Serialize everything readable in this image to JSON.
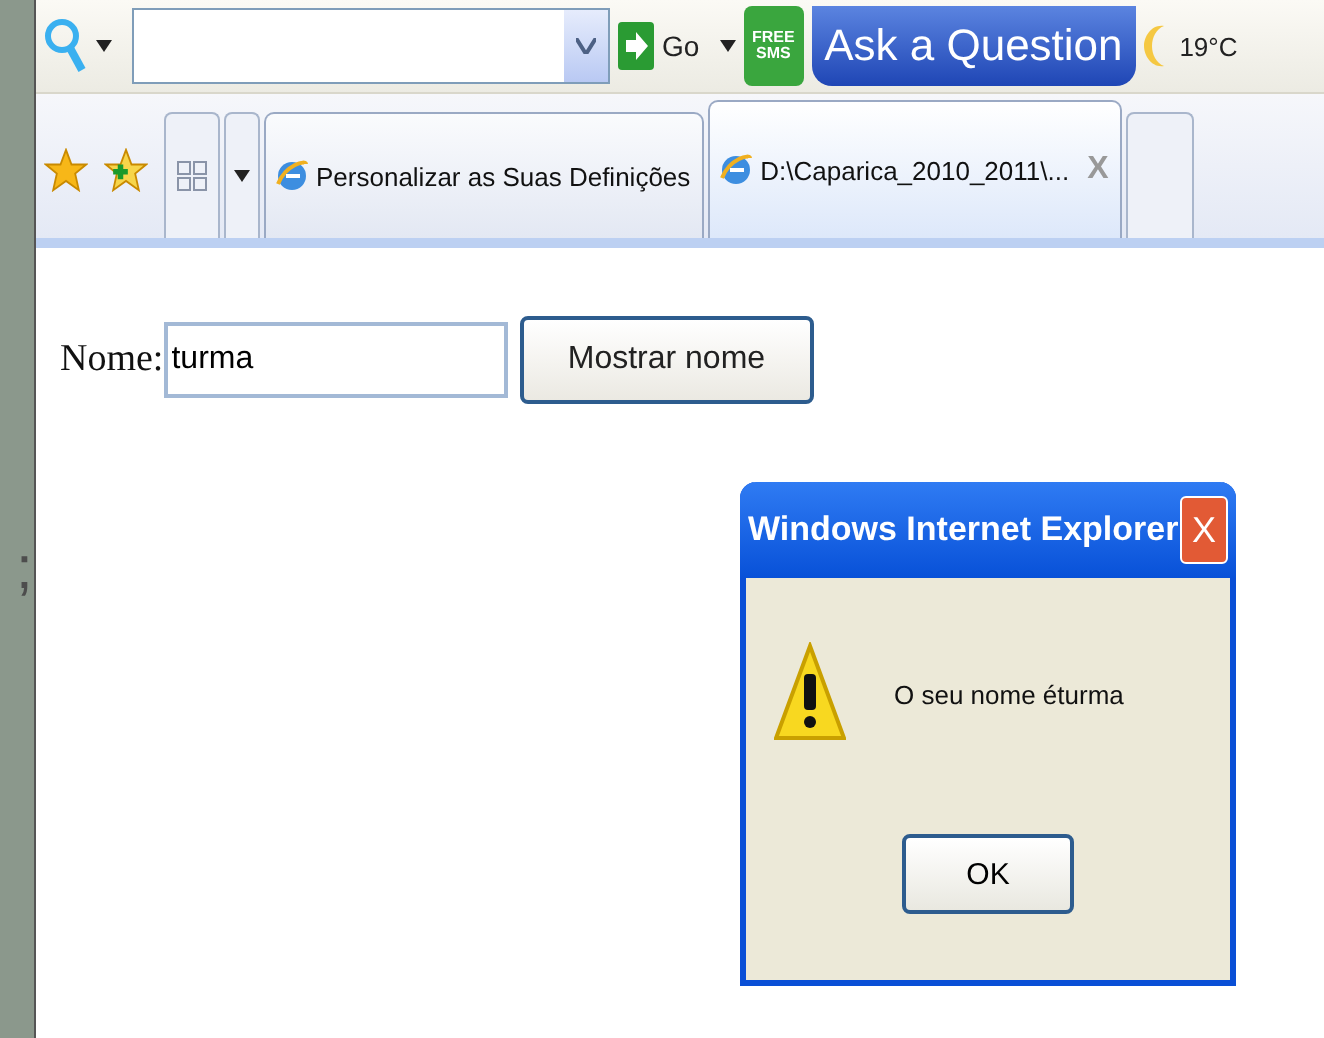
{
  "side_text": ";",
  "toolbar": {
    "go_label": "Go",
    "sms_badge": [
      "FREE",
      "SMS"
    ],
    "ask_button": "Ask a Question",
    "weather": "19°C"
  },
  "tabs": [
    {
      "label": "Personalizar as Suas Definições",
      "selected": false
    },
    {
      "label": "D:\\Caparica_2010_2011\\...",
      "selected": true
    }
  ],
  "tab_close": "X",
  "form": {
    "label": "Nome:",
    "value": "turma",
    "button": "Mostrar nome"
  },
  "dialog": {
    "title": "Windows Internet Explorer",
    "close": "X",
    "message": "O seu nome éturma",
    "button": "OK"
  }
}
